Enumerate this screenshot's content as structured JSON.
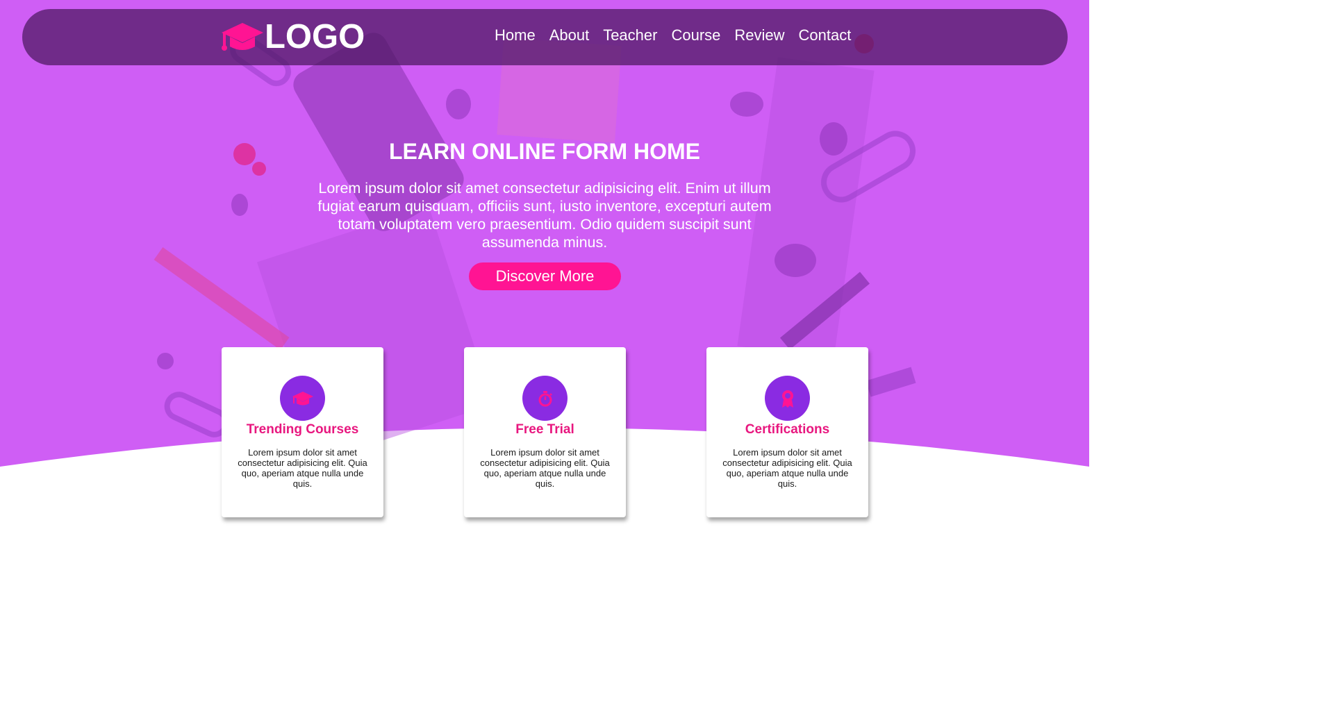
{
  "colors": {
    "hero_purple": "#cf5ef5",
    "nav_bg": "#4b185f",
    "accent_pink": "#ff1493",
    "icon_purple": "#8a2be2",
    "card_title": "#e8177f"
  },
  "header": {
    "logo_icon": "graduation-cap-icon",
    "logo_text": "LOGO",
    "nav": [
      {
        "label": "Home"
      },
      {
        "label": "About"
      },
      {
        "label": "Teacher"
      },
      {
        "label": "Course"
      },
      {
        "label": "Review"
      },
      {
        "label": "Contact"
      }
    ]
  },
  "hero": {
    "title": "LEARN ONLINE FORM HOME",
    "text": "Lorem ipsum dolor sit amet consectetur adipisicing elit. Enim ut illum fugiat earum quisquam, officiis sunt, iusto inventore, excepturi autem totam voluptatem vero praesentium. Odio quidem suscipit sunt assumenda minus.",
    "button_label": "Discover More"
  },
  "features": [
    {
      "icon": "graduation-cap-icon",
      "title": "Trending Courses",
      "text": "Lorem ipsum dolor sit amet consectetur adipisicing elit. Quia quo, aperiam atque nulla unde quis."
    },
    {
      "icon": "stopwatch-icon",
      "title": "Free Trial",
      "text": "Lorem ipsum dolor sit amet consectetur adipisicing elit. Quia quo, aperiam atque nulla unde quis."
    },
    {
      "icon": "award-icon",
      "title": "Certifications",
      "text": "Lorem ipsum dolor sit amet consectetur adipisicing elit. Quia quo, aperiam atque nulla unde quis."
    }
  ]
}
